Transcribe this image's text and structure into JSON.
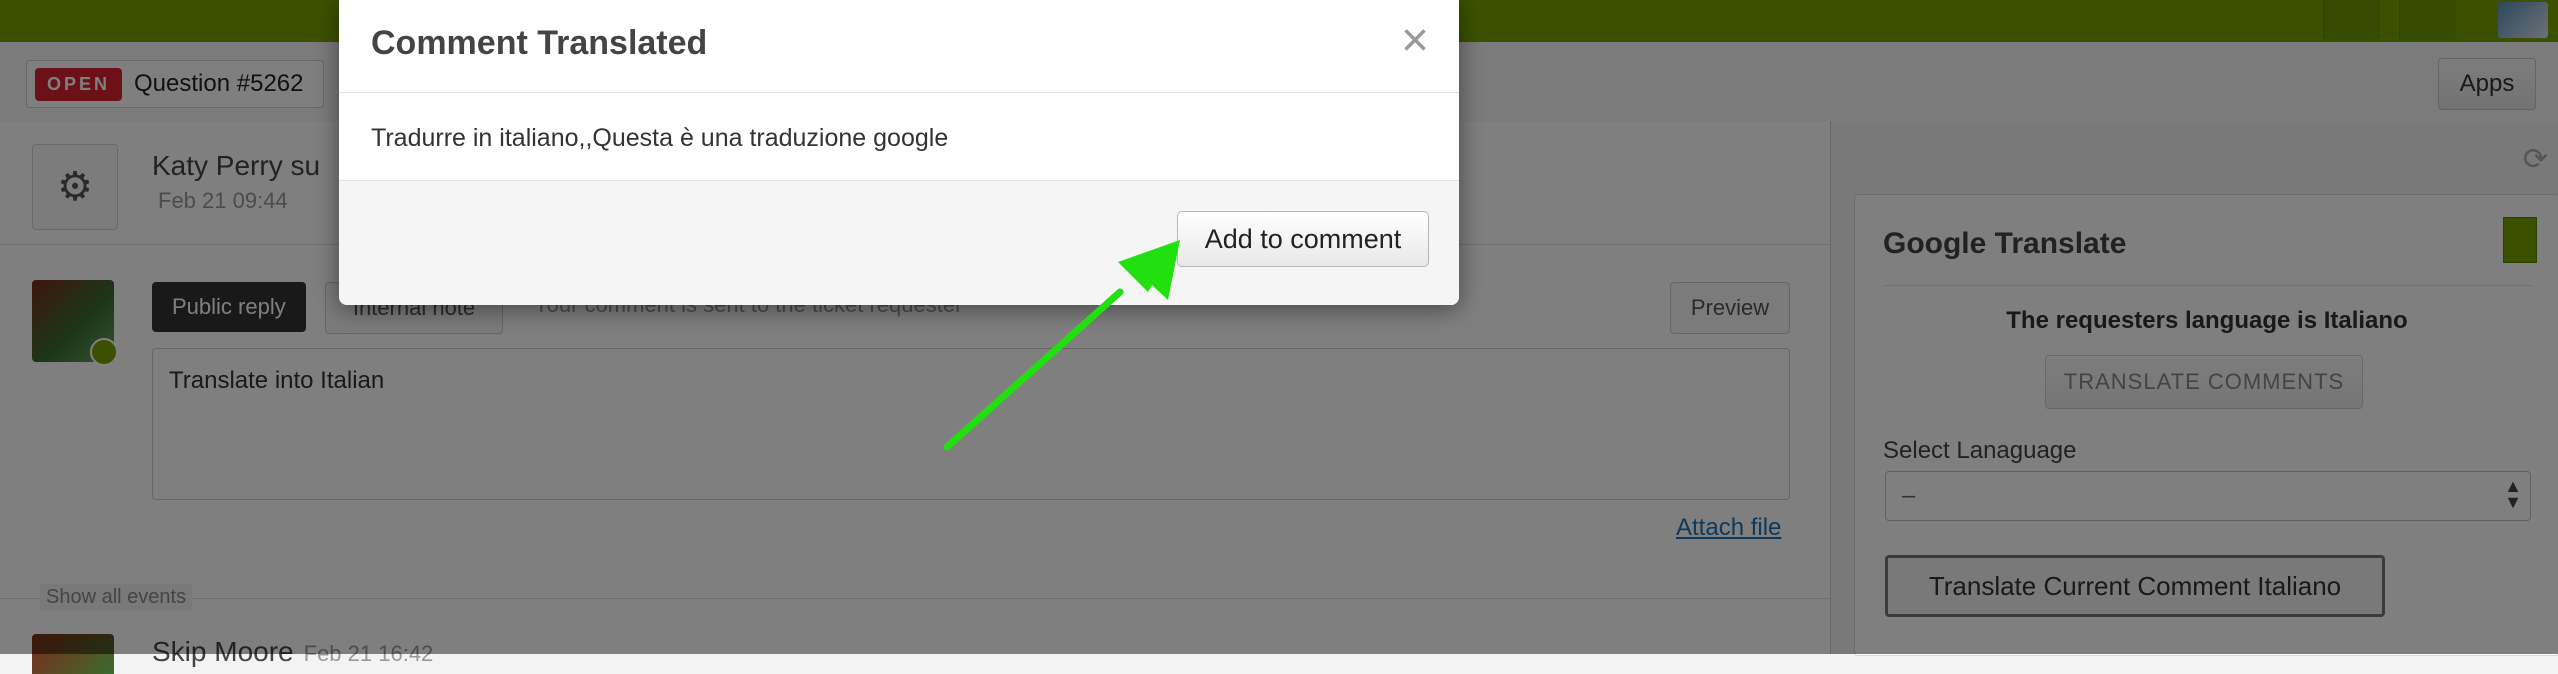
{
  "ticket": {
    "status": "OPEN",
    "title": "Question #5262",
    "subject": "Katy Perry su",
    "date": "Feb 21 09:44",
    "reply_tab": "Public reply",
    "internal_tab": "Internal note",
    "requester_note": "Your comment is sent to the ticket requester",
    "preview": "Preview",
    "comment_text": "Translate into Italian",
    "attach": "Attach file",
    "show_events": "Show all events",
    "next_author": "Skip Moore",
    "next_date": "Feb 21 16:42"
  },
  "header": {
    "apps": "Apps"
  },
  "sidebar": {
    "app_title": "Google Translate",
    "language_msg": "The requesters language is Italiano",
    "translate_comments": "TRANSLATE COMMENTS",
    "select_label": "Select Lanaguage",
    "select_value": "–",
    "translate_current": "Translate Current Comment Italiano"
  },
  "modal": {
    "title": "Comment Translated",
    "body": "Tradurre in italiano,,Questa è una traduzione google",
    "add_button": "Add to comment"
  },
  "colors": {
    "brand": "#78a300",
    "open_badge": "#d9232f",
    "arrow": "#22e010"
  },
  "icons": {
    "gear": "gear-icon",
    "close": "close-icon",
    "refresh": "refresh-icon",
    "select_arrows": "select-arrows-icon"
  }
}
